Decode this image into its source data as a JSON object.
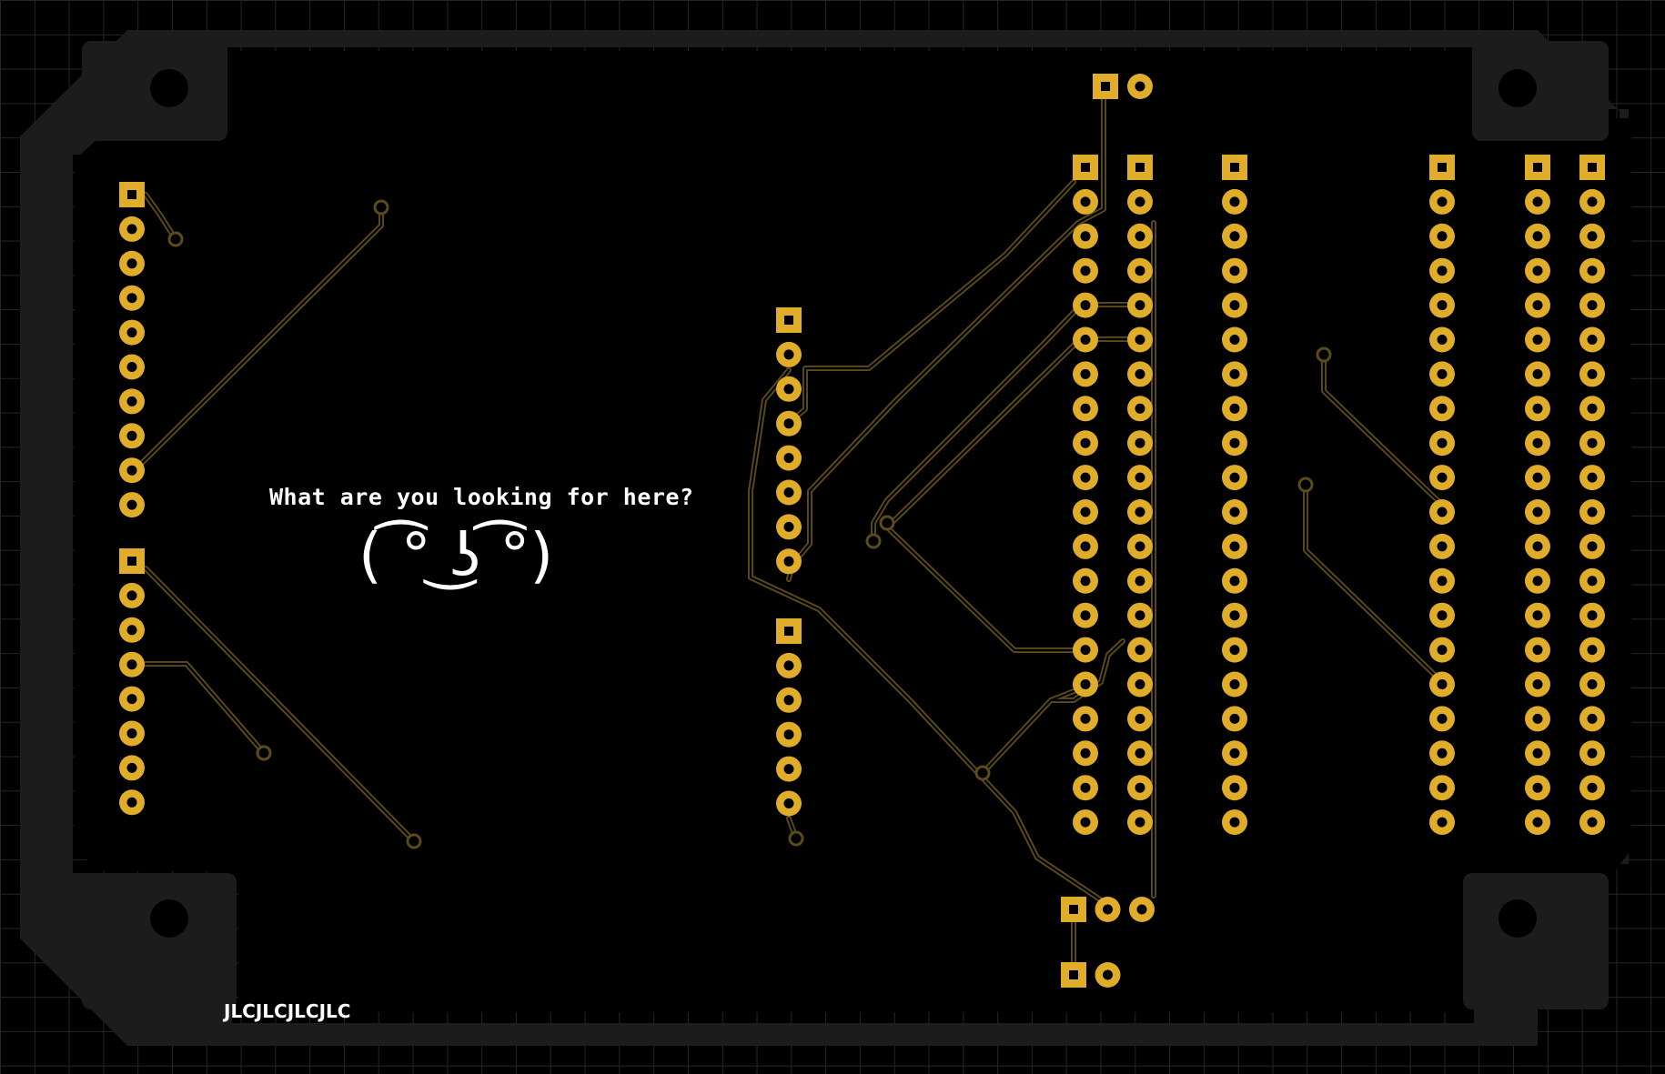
{
  "board": {
    "silkscreen_message": "What are you looking for here?",
    "silkscreen_face": "( ͡° ͜ʖ ͡°)",
    "silkscreen_brand": "JLCJLCJLCJLC"
  },
  "colors": {
    "background": "#000000",
    "grid": "#262626",
    "board_edge": "#1c1c1c",
    "copper_pad": "#e0ad2a",
    "trace_outline": "#5a4a1c"
  }
}
